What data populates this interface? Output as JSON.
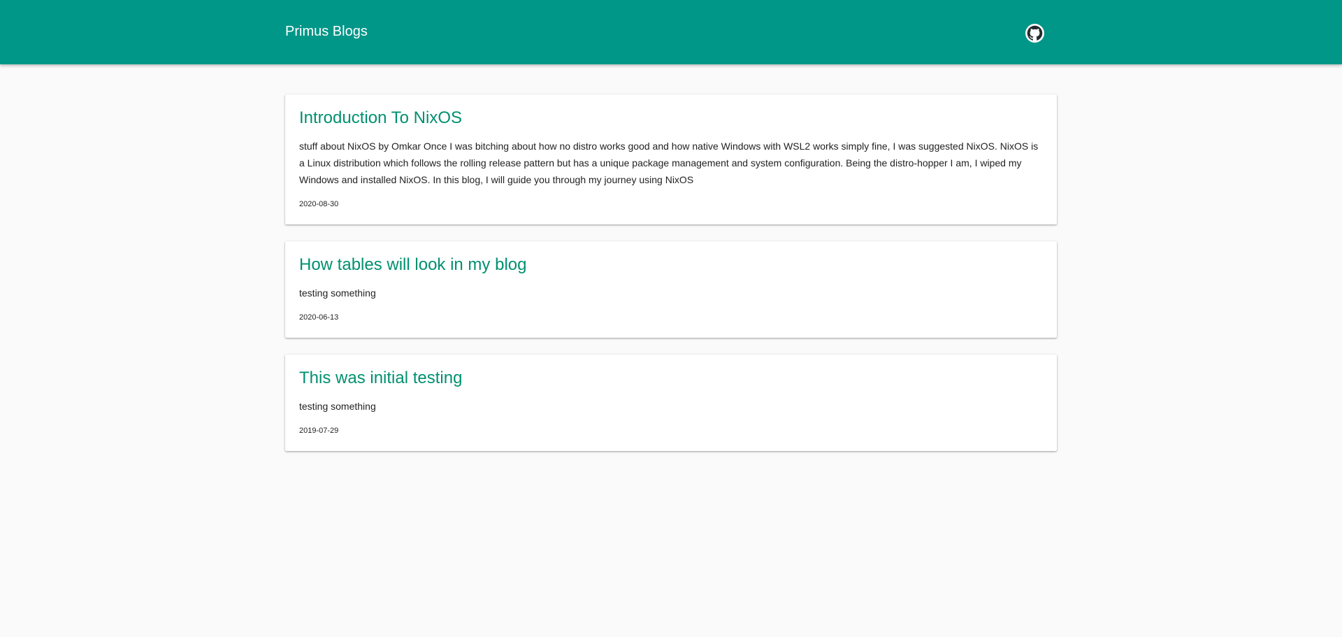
{
  "header": {
    "brand": "Primus Blogs",
    "github_icon": "github-icon",
    "background_color": "#009688"
  },
  "posts": [
    {
      "title": "Introduction To NixOS",
      "excerpt": "stuff about NixOS by Omkar Once I was bitching about how no distro works good and how native Windows with WSL2 works simply fine, I was suggested NixOS. NixOS is a Linux distribution which follows the rolling release pattern but has a unique package management and system configuration. Being the distro-hopper I am, I wiped my Windows and installed NixOS. In this blog, I will guide you through my journey using NixOS",
      "date": "2020-08-30"
    },
    {
      "title": "How tables will look in my blog",
      "excerpt": "testing something",
      "date": "2020-06-13"
    },
    {
      "title": "This was initial testing",
      "excerpt": "testing something",
      "date": "2019-07-29"
    }
  ],
  "colors": {
    "accent": "#009688",
    "title_link": "#009070",
    "page_background": "#fafafa"
  }
}
